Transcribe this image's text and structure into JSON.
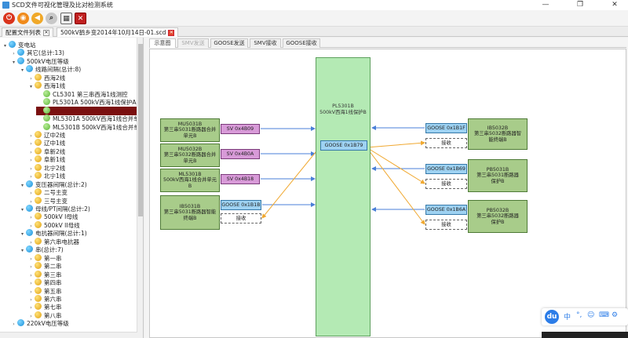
{
  "window": {
    "title": "SCD文件可视化管理及比对检测系统",
    "controls": [
      "—",
      "❐",
      "✕"
    ]
  },
  "toolbar": {
    "buttons": [
      "exit",
      "open",
      "back",
      "search",
      "calendar",
      "excel"
    ]
  },
  "tabs": [
    {
      "label": "配置文件列表"
    },
    {
      "label": "500kV鹤乡变2014年10月14日-01.scd"
    }
  ],
  "tree": {
    "rows": [
      {
        "label": "变电站",
        "icon": "blue",
        "expanded": true
      },
      {
        "label": "其它(总计:13)",
        "icon": "blue",
        "expanded": false
      },
      {
        "label": "500kV电压等级",
        "icon": "blue",
        "expanded": true
      },
      {
        "label": "线路间隔(总计:8)",
        "icon": "blue",
        "expanded": true
      },
      {
        "label": "西海2线",
        "icon": "yellow",
        "expanded": false
      },
      {
        "label": "西海1线",
        "icon": "yellow",
        "expanded": true
      },
      {
        "label": "CL5301  第三串西海1线测控",
        "icon": "green"
      },
      {
        "label": "PL5301A  500kV西海1线保护A",
        "icon": "green"
      },
      {
        "label": "",
        "icon": "green",
        "selected": true
      },
      {
        "label": "ML5301A  500kV西海1线合并单",
        "icon": "green"
      },
      {
        "label": "ML5301B  500kV西海1线合并单",
        "icon": "green"
      },
      {
        "label": "辽中2线",
        "icon": "yellow",
        "expanded": false
      },
      {
        "label": "辽中1线",
        "icon": "yellow",
        "expanded": false
      },
      {
        "label": "阜新2线",
        "icon": "yellow",
        "expanded": false
      },
      {
        "label": "阜新1线",
        "icon": "yellow",
        "expanded": false
      },
      {
        "label": "北宁2线",
        "icon": "yellow",
        "expanded": false
      },
      {
        "label": "北宁1线",
        "icon": "yellow",
        "expanded": false
      },
      {
        "label": "变压器间隔(总计:2)",
        "icon": "blue",
        "expanded": true
      },
      {
        "label": "二号主变",
        "icon": "yellow",
        "expanded": false
      },
      {
        "label": "三号主变",
        "icon": "yellow",
        "expanded": false
      },
      {
        "label": "母线/PT间隔(总计:2)",
        "icon": "blue",
        "expanded": true
      },
      {
        "label": "500kV I母线",
        "icon": "yellow",
        "expanded": false
      },
      {
        "label": "500kV II母线",
        "icon": "yellow",
        "expanded": false
      },
      {
        "label": "电抗器间隔(总计:1)",
        "icon": "blue",
        "expanded": true
      },
      {
        "label": "第六串电抗器",
        "icon": "yellow",
        "expanded": false
      },
      {
        "label": "串(总计:7)",
        "icon": "blue",
        "expanded": true
      },
      {
        "label": "第一串",
        "icon": "yellow",
        "expanded": false
      },
      {
        "label": "第二串",
        "icon": "yellow",
        "expanded": false
      },
      {
        "label": "第三串",
        "icon": "yellow",
        "expanded": false
      },
      {
        "label": "第四串",
        "icon": "yellow",
        "expanded": false
      },
      {
        "label": "第五串",
        "icon": "yellow",
        "expanded": false
      },
      {
        "label": "第六串",
        "icon": "yellow",
        "expanded": false
      },
      {
        "label": "第七串",
        "icon": "yellow",
        "expanded": false
      },
      {
        "label": "第八串",
        "icon": "yellow",
        "expanded": false
      },
      {
        "label": "220kV电压等级",
        "icon": "blue",
        "expanded": false
      }
    ]
  },
  "subtabs": [
    {
      "label": "示意图",
      "active": true
    },
    {
      "label": "SMV发送",
      "dim": true
    },
    {
      "label": "GOOSE发送"
    },
    {
      "label": "SMV接收"
    },
    {
      "label": "GOOSE接收"
    }
  ],
  "diagram": {
    "center": {
      "id": "PL5301B",
      "name": "500kV西海1线保护B",
      "goose_out": "GOOSE 0x1B79"
    },
    "left_nodes": [
      {
        "id": "MU5031B",
        "name": "第三串5031断路器合并单元B",
        "port": "SV 0x4B09",
        "port_type": "sv"
      },
      {
        "id": "MU5032B",
        "name": "第三串5032断路器合并单元B",
        "port": "SV 0x4B0A",
        "port_type": "sv"
      },
      {
        "id": "ML5301B",
        "name": "500kV西海1线合并单元B",
        "port": "SV 0x4B18",
        "port_type": "sv"
      },
      {
        "id": "IB5031B",
        "name": "第三串5031断路器智能终端B",
        "port": "GOOSE 0x1B1B",
        "port_type": "goose",
        "recv": "接收"
      }
    ],
    "right_nodes": [
      {
        "id": "IB5032B",
        "name": "第三串5032断路器智能终端B",
        "port": "GOOSE 0x1B1F",
        "recv": "接收"
      },
      {
        "id": "PB5031B",
        "name": "第三串5031断路器保护B",
        "port": "GOOSE 0x1B69",
        "recv": "接收"
      },
      {
        "id": "PB5032B",
        "name": "第三串5032断路器保护B",
        "port": "GOOSE 0x1B6A",
        "recv": "接收"
      }
    ],
    "colors": {
      "sv_link": "#4a7fd8",
      "goose_link": "#f0a830",
      "node_fill": "#a8cc8a",
      "center_fill": "#b4eab4"
    }
  },
  "ime": {
    "logo": "du",
    "items": [
      "中",
      "°,",
      "☺",
      "⌨",
      "⚙"
    ]
  }
}
